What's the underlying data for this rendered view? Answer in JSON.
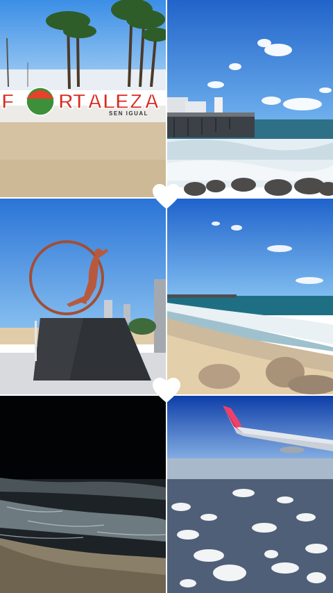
{
  "sign": {
    "letters": [
      "F",
      "O",
      "R",
      "T",
      "A",
      "L",
      "E",
      "Z",
      "A"
    ],
    "tagline": "SEN IGUAL"
  },
  "colors": {
    "sky": "#2d7fd8",
    "sign_red": "#d92a22",
    "sand": "#d8c4a0",
    "ocean": "#2a6f87",
    "heart": "#ffffff"
  },
  "icons": [
    "heart-icon",
    "heart-icon"
  ]
}
